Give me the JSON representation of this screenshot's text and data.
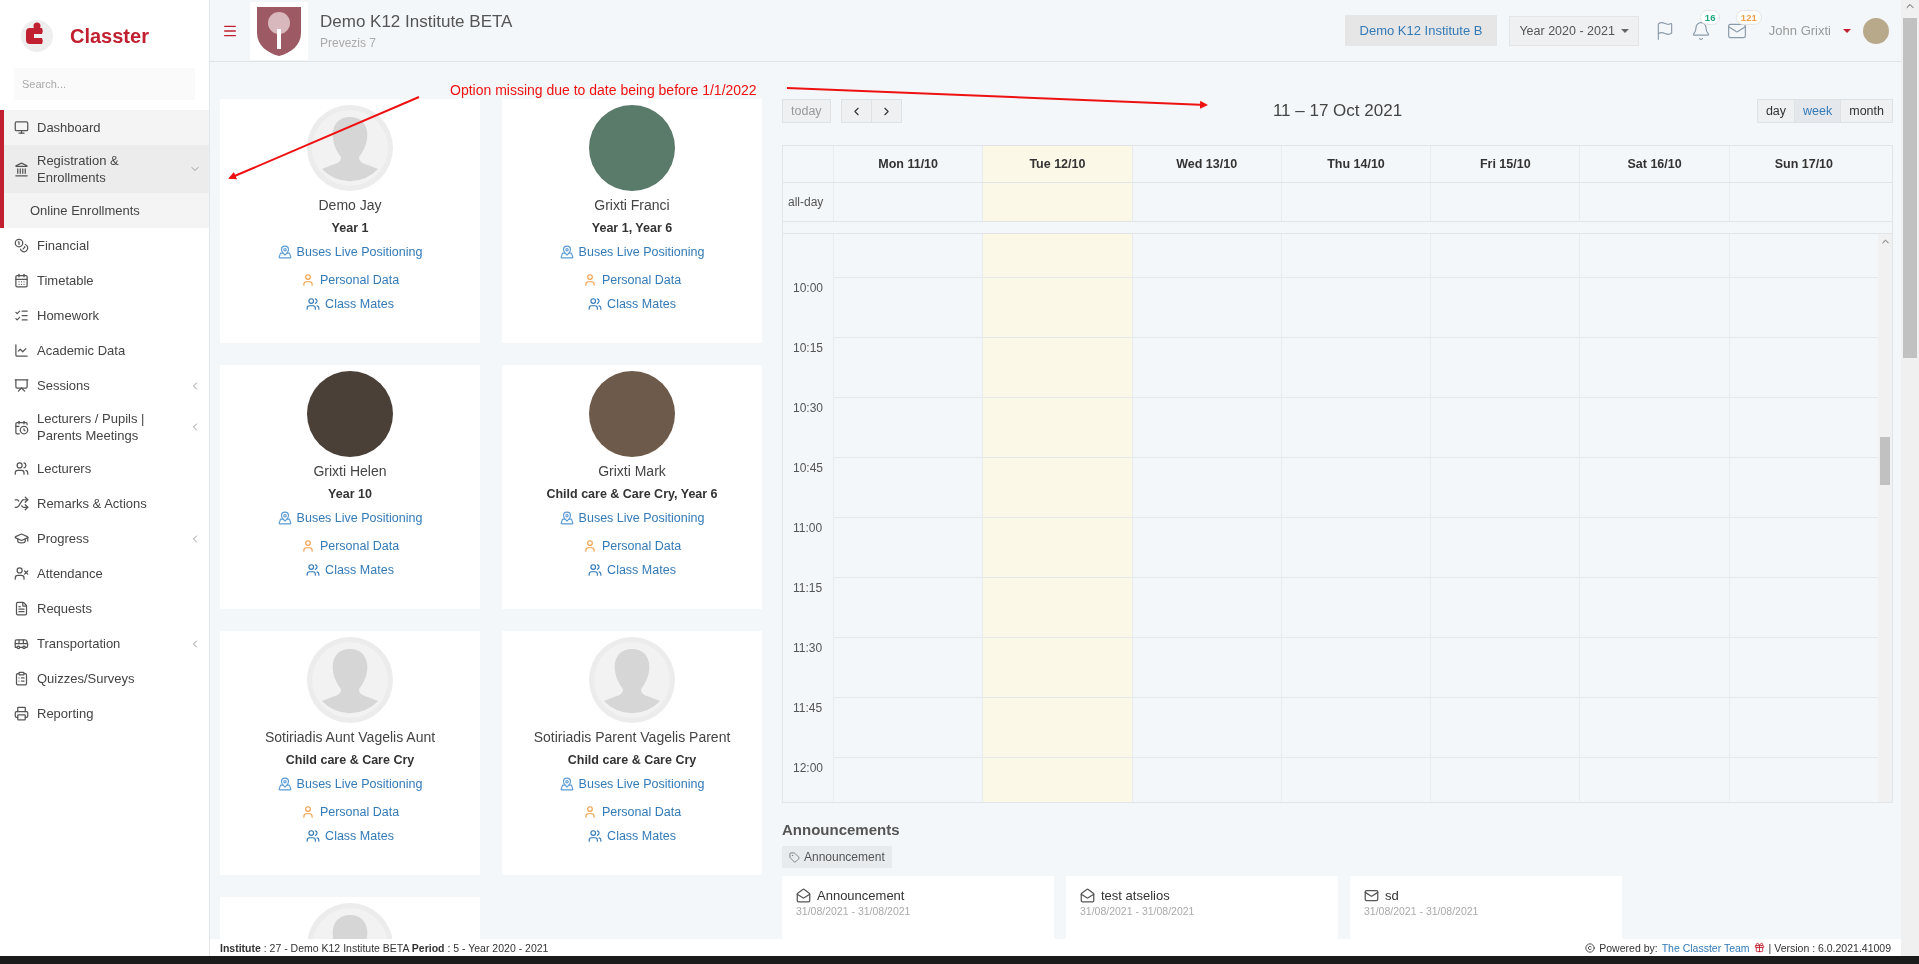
{
  "sidebar": {
    "logo_text": "Classter",
    "search": {
      "placeholder": "Search..."
    },
    "items": [
      {
        "label": "Dashboard",
        "kind": "link",
        "selected": true,
        "expanded": false
      },
      {
        "label": "Registration & Enrollments",
        "kind": "group",
        "selected": false,
        "expanded": true,
        "children": [
          {
            "label": "Online Enrollments",
            "selected": false
          }
        ]
      },
      {
        "label": "Financial",
        "kind": "link",
        "selected": false,
        "expanded": false
      },
      {
        "label": "Timetable",
        "kind": "link",
        "selected": false,
        "expanded": false
      },
      {
        "label": "Homework",
        "kind": "link",
        "selected": false,
        "expanded": false
      },
      {
        "label": "Academic Data",
        "kind": "link",
        "selected": false,
        "expanded": false
      },
      {
        "label": "Sessions",
        "kind": "group",
        "selected": false,
        "expanded": false
      },
      {
        "label": "Lecturers / Pupils | Parents Meetings",
        "kind": "group",
        "selected": false,
        "expanded": false
      },
      {
        "label": "Lecturers",
        "kind": "link",
        "selected": false,
        "expanded": false
      },
      {
        "label": "Remarks & Actions",
        "kind": "link",
        "selected": false,
        "expanded": false
      },
      {
        "label": "Progress",
        "kind": "group",
        "selected": false,
        "expanded": false
      },
      {
        "label": "Attendance",
        "kind": "link",
        "selected": false,
        "expanded": false
      },
      {
        "label": "Requests",
        "kind": "link",
        "selected": false,
        "expanded": false
      },
      {
        "label": "Transportation",
        "kind": "group",
        "selected": false,
        "expanded": false
      },
      {
        "label": "Quizzes/Surveys",
        "kind": "link",
        "selected": false,
        "expanded": false
      },
      {
        "label": "Reporting",
        "kind": "link",
        "selected": false,
        "expanded": false
      }
    ]
  },
  "header": {
    "institute_name": "Demo K12 Institute BETA",
    "institute_address": "Prevezis 7",
    "institute_switch": "Demo K12 Institute B",
    "year_select": "Year 2020 - 2021",
    "notifications_count": "16",
    "messages_count": "121",
    "user_name": "John Grixti"
  },
  "annotation": {
    "text": "Option missing due to date being before 1/1/2022"
  },
  "students": [
    {
      "kind": "silhouette",
      "name": "Demo Jay",
      "classes": "Year 1",
      "links": [
        "Buses Live Positioning",
        "Personal Data",
        "Class Mates"
      ]
    },
    {
      "kind": "photo",
      "name": "Grixti Franci",
      "classes": "Year 1, Year 6",
      "links": [
        "Buses Live Positioning",
        "Personal Data",
        "Class Mates"
      ]
    },
    {
      "kind": "photo",
      "name": "Grixti Helen",
      "classes": "Year 10",
      "links": [
        "Buses Live Positioning",
        "Personal Data",
        "Class Mates"
      ]
    },
    {
      "kind": "photo",
      "name": "Grixti Mark",
      "classes": "Child care & Care Cry, Year 6",
      "links": [
        "Buses Live Positioning",
        "Personal Data",
        "Class Mates"
      ]
    },
    {
      "kind": "silhouette",
      "name": "Sotiriadis Aunt Vagelis Aunt",
      "classes": "Child care & Care Cry",
      "links": [
        "Buses Live Positioning",
        "Personal Data",
        "Class Mates"
      ]
    },
    {
      "kind": "silhouette",
      "name": "Sotiriadis Parent Vagelis Parent",
      "classes": "Child care & Care Cry",
      "links": [
        "Buses Live Positioning",
        "Personal Data",
        "Class Mates"
      ]
    },
    {
      "kind": "silhouette"
    }
  ],
  "calendar": {
    "today_button": {
      "label": "today",
      "disabled": true
    },
    "title": "11 – 17 Oct 2021",
    "views": [
      {
        "label": "day",
        "selected": false
      },
      {
        "label": "week",
        "selected": true
      },
      {
        "label": "month",
        "selected": false
      }
    ],
    "days": [
      {
        "label": "Mon 11/10",
        "today": false
      },
      {
        "label": "Tue 12/10",
        "today": true
      },
      {
        "label": "Wed 13/10",
        "today": false
      },
      {
        "label": "Thu 14/10",
        "today": false
      },
      {
        "label": "Fri 15/10",
        "today": false
      },
      {
        "label": "Sat 16/10",
        "today": false
      },
      {
        "label": "Sun 17/10",
        "today": false
      }
    ],
    "all_day_label": "all-day",
    "times": [
      "10:00",
      "10:15",
      "10:30",
      "10:45",
      "11:00",
      "11:15",
      "11:30",
      "11:45",
      "12:00"
    ]
  },
  "announcements": {
    "title": "Announcements",
    "filter_tag": "Announcement",
    "items": [
      {
        "kind": "opened",
        "title": "Announcement",
        "dates": "31/08/2021 - 31/08/2021"
      },
      {
        "kind": "opened",
        "title": "test atselios",
        "dates": "31/08/2021 - 31/08/2021"
      },
      {
        "kind": "closed",
        "title": "sd",
        "dates": "31/08/2021 - 31/08/2021"
      }
    ]
  },
  "footer": {
    "info": "**Institute** : 27 - Demo K12 Institute BETA **Period** : 5 - Year 2020 - 2021",
    "powered_by": "Powered by:",
    "team_link": "The Classter Team",
    "version": "| Version : 6.0.2021.41009"
  }
}
